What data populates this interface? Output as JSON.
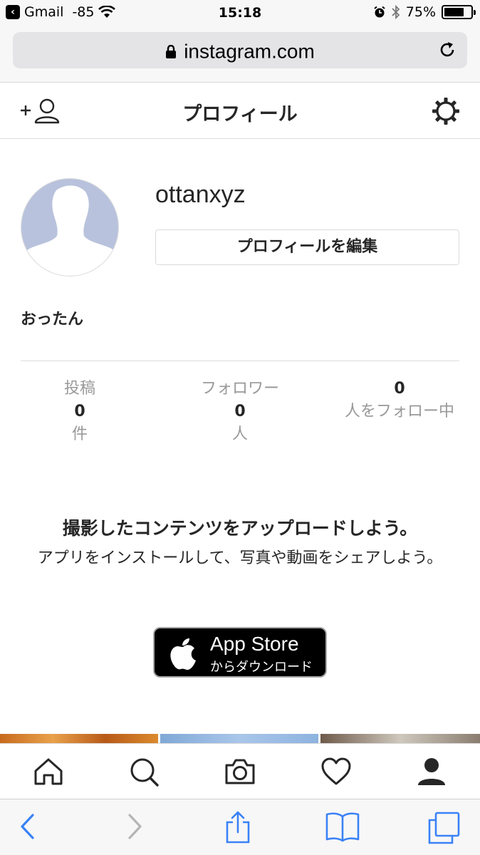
{
  "status_bar": {
    "back_app": "Gmail",
    "signal": "-85",
    "time": "15:18",
    "battery": "75%",
    "battery_level": 0.75
  },
  "address_bar": {
    "url": "instagram.com"
  },
  "header": {
    "title": "プロフィール"
  },
  "profile": {
    "username": "ottanxyz",
    "edit_button": "プロフィールを編集",
    "full_name": "おったん"
  },
  "stats": [
    {
      "label": "投稿",
      "value": "0",
      "unit": "件"
    },
    {
      "label": "フォロワー",
      "value": "0",
      "unit": "人"
    },
    {
      "label": "",
      "value": "0",
      "unit": "人をフォロー中"
    }
  ],
  "upload": {
    "title": "撮影したコンテンツをアップロードしよう。",
    "description": "アプリをインストールして、写真や動画をシェアしよう。"
  },
  "app_store": {
    "main": "App Store",
    "sub": "からダウンロード"
  },
  "nav_icons": [
    "home-icon",
    "search-icon",
    "camera-icon",
    "heart-icon",
    "profile-icon"
  ],
  "safari_icons": [
    "back-icon",
    "forward-icon",
    "share-icon",
    "bookmarks-icon",
    "tabs-icon"
  ],
  "colors": {
    "accent": "#3a82f7",
    "text": "#262626",
    "muted": "#999999",
    "avatar": "#b8c2dc"
  }
}
